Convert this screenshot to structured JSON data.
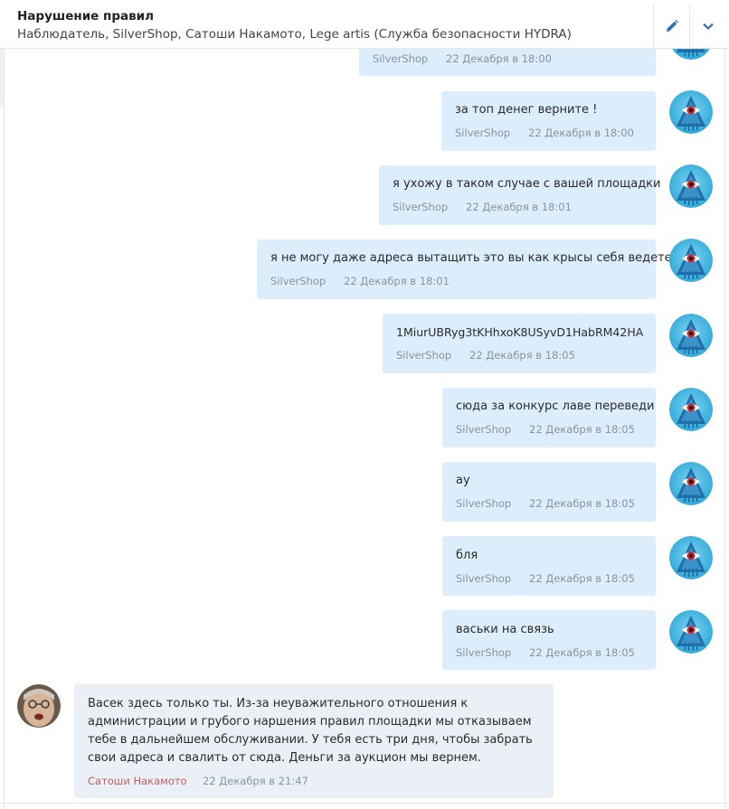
{
  "header": {
    "title": "Нарушение правил",
    "members": "Наблюдатель, SilverShop, Сатоши Накамото, Lege artis (Служба безопасности HYDRA)",
    "edit_icon": "pencil-icon",
    "menu_icon": "chevron-down-icon"
  },
  "messages": [
    {
      "text": "",
      "author": "SilverShop",
      "time": "22 Декабря в 18:00"
    },
    {
      "text": "за топ денег верните !",
      "author": "SilverShop",
      "time": "22 Декабря в 18:00"
    },
    {
      "text": "я ухожу в таком случае с вашей площадки",
      "author": "SilverShop",
      "time": "22 Декабря в 18:01"
    },
    {
      "text": "я не могу даже адреса вытащить это вы как крысы себя ведете",
      "author": "SilverShop",
      "time": "22 Декабря в 18:01"
    },
    {
      "text": "1MiurUBRyg3tKHhxoK8USyvD1HabRM42HA",
      "author": "SilverShop",
      "time": "22 Декабря в 18:05"
    },
    {
      "text": "сюда за конкурс лаве переведи",
      "author": "SilverShop",
      "time": "22 Декабря в 18:05"
    },
    {
      "text": "ау",
      "author": "SilverShop",
      "time": "22 Декабря в 18:05"
    },
    {
      "text": "бля",
      "author": "SilverShop",
      "time": "22 Декабря в 18:05"
    },
    {
      "text": "васьки на связь",
      "author": "SilverShop",
      "time": "22 Декабря в 18:05"
    },
    {
      "text": "Васек здесь только ты. Из-за неуважительного отношения к администрации и грубого наршения правил площадки мы отказываем тебе в дальнейшем обслуживании. У тебя есть три дня, чтобы забрать свои адреса и свалить от сюда. Деньги за аукцион мы вернем.",
      "author": "Сатоши Накамото",
      "time": "22 Декабря в 21:47"
    }
  ],
  "colors": {
    "outgoing_bubble": "#dcedfb",
    "incoming_bubble": "#ebf0f7",
    "meta_text": "#8a949e",
    "admin_name": "#c0605e"
  }
}
